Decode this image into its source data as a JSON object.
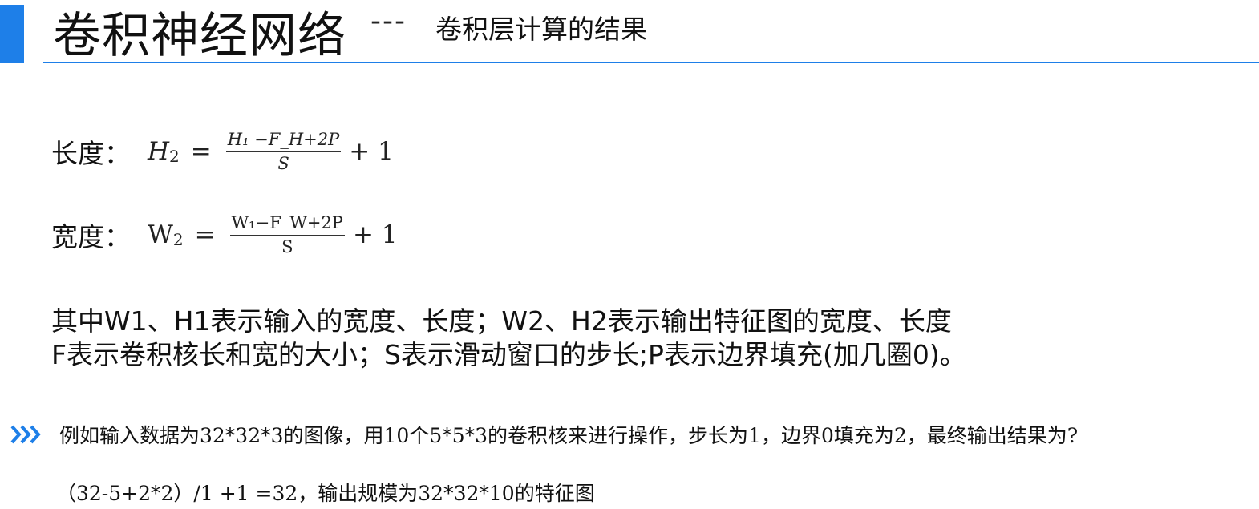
{
  "header": {
    "title": "卷积神经网络",
    "dash": "---",
    "subtitle": "卷积层计算的结果",
    "accent_color": "#1e7fe8"
  },
  "formulas": {
    "height": {
      "label": "长度：",
      "lhs_var": "H",
      "lhs_sub": "2",
      "equals": "=",
      "numerator": "H₁ −F_H+2P",
      "denominator": "S",
      "tail": "+ 1"
    },
    "width": {
      "label": "宽度：",
      "lhs_var": "W",
      "lhs_sub": "2",
      "equals": "=",
      "numerator": "W₁−F_W+2P",
      "denominator": "S",
      "tail": "+ 1"
    }
  },
  "description": {
    "line1": "其中W1、H1表示输入的宽度、长度；W2、H2表示输出特征图的宽度、长度",
    "line2": "F表示卷积核长和宽的大小；S表示滑动窗口的步长;P表示边界填充(加几圈0)。"
  },
  "example": {
    "icon": "triple-chevron-right-icon",
    "text": "例如输入数据为32*32*3的图像，用10个5*5*3的卷积核来进行操作，步长为1，边界0填充为2，最终输出结果为?",
    "answer": "（32-5+2*2）/1 +1 =32，输出规模为32*32*10的特征图"
  }
}
